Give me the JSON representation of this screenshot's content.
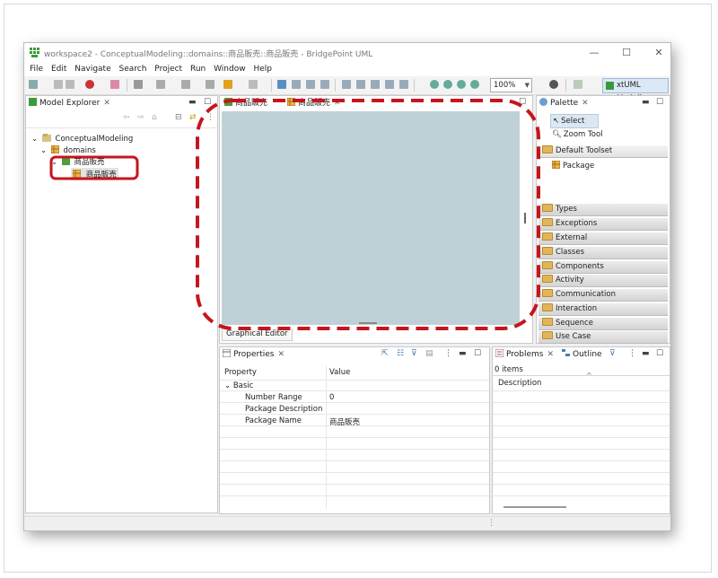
{
  "window": {
    "title": "workspace2 - ConceptualModeling::domains::商品販売::商品販売 - BridgePoint UML",
    "minimize": "—",
    "maximize": "☐",
    "close": "✕"
  },
  "menu": [
    "File",
    "Edit",
    "Navigate",
    "Search",
    "Project",
    "Run",
    "Window",
    "Help"
  ],
  "toolbar": {
    "zoom": "100%",
    "perspective": "xtUML Modeling"
  },
  "model_explorer": {
    "tab": "Model Explorer",
    "tree": [
      {
        "label": "ConceptualModeling"
      },
      {
        "label": "domains"
      },
      {
        "label": "商品販売"
      },
      {
        "label": "商品販売"
      }
    ]
  },
  "editor": {
    "tabs": [
      "商品販売",
      "商品販売"
    ],
    "bottom_tab": "Graphical Editor"
  },
  "palette": {
    "tab": "Palette",
    "tools": [
      "Select",
      "Zoom Tool"
    ],
    "toolset": "Default Toolset",
    "toolset_items": [
      "Package"
    ],
    "drawers": [
      "Types",
      "Exceptions",
      "External",
      "Classes",
      "Components",
      "Activity",
      "Communication",
      "Interaction",
      "Sequence",
      "Use Case"
    ]
  },
  "properties": {
    "tab": "Properties",
    "col_property": "Property",
    "col_value": "Value",
    "group": "Basic",
    "rows": [
      {
        "name": "Number Range",
        "value": "0"
      },
      {
        "name": "Package Description",
        "value": ""
      },
      {
        "name": "Package Name",
        "value": "商品販売"
      }
    ]
  },
  "problems": {
    "tab": "Problems",
    "tab2": "Outline",
    "count": "0 items",
    "col_description": "Description"
  },
  "colors": {
    "highlight": "#c5161d",
    "canvas": "#c0d1d6"
  }
}
